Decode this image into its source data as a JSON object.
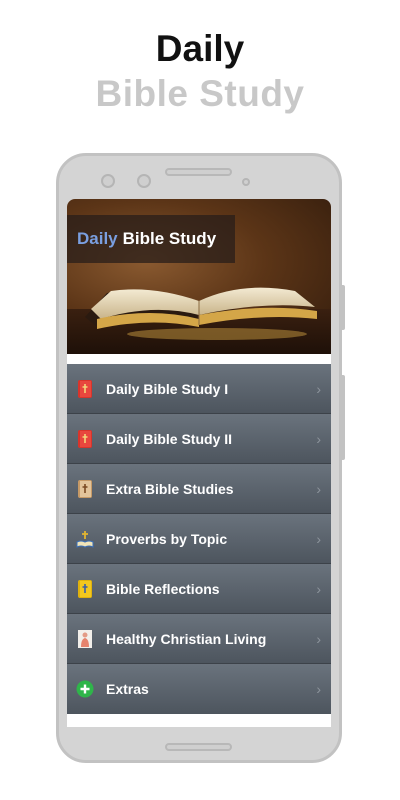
{
  "promo": {
    "line1": "Daily",
    "line2": "Bible Study"
  },
  "banner": {
    "title_part1": "Daily",
    "title_part2": "Bible Study"
  },
  "menu": {
    "items": [
      {
        "label": "Daily Bible Study I",
        "icon": "red-bible-icon"
      },
      {
        "label": "Daily Bible Study II",
        "icon": "red-bible-icon"
      },
      {
        "label": "Extra Bible Studies",
        "icon": "tan-bible-icon"
      },
      {
        "label": "Proverbs by Topic",
        "icon": "open-book-cross-icon"
      },
      {
        "label": "Bible Reflections",
        "icon": "yellow-bible-icon"
      },
      {
        "label": "Healthy Christian Living",
        "icon": "praying-figure-icon"
      },
      {
        "label": "Extras",
        "icon": "green-plus-icon"
      }
    ],
    "chevron": "›"
  },
  "colors": {
    "accent": "#7a9fe0",
    "menu_top": "#6a737d",
    "menu_bottom": "#4d555e"
  }
}
